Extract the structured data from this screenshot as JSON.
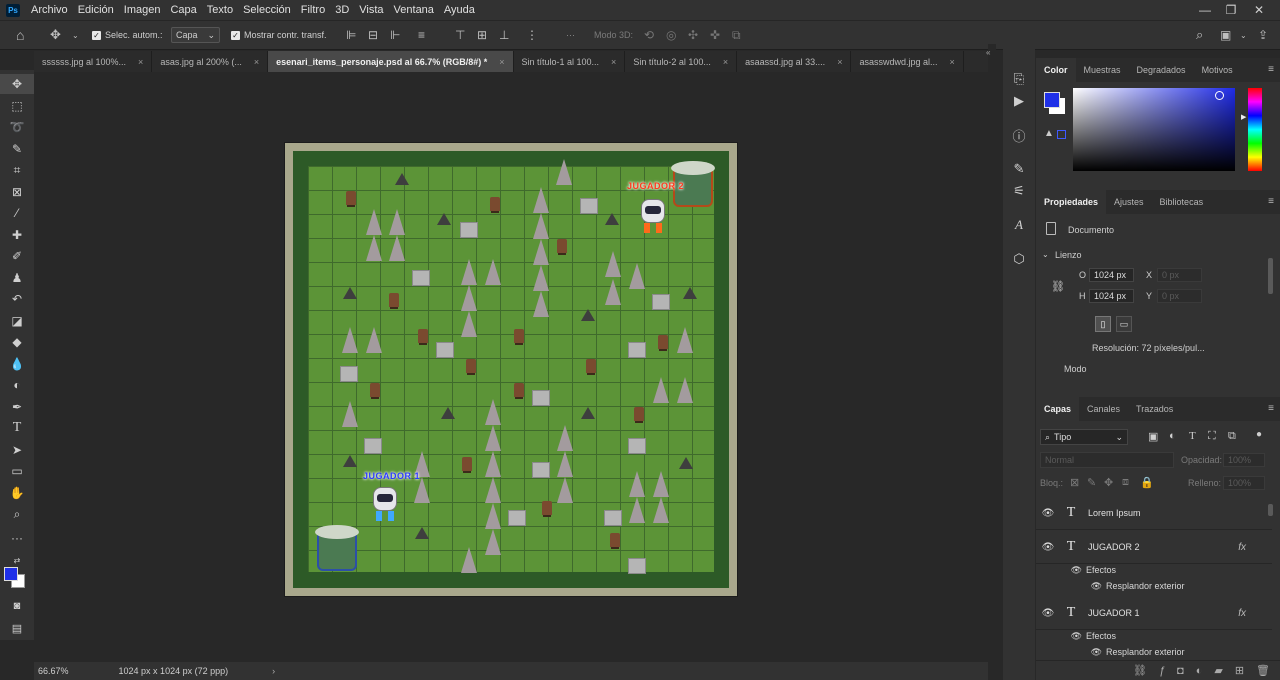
{
  "app": {
    "logo": "Ps"
  },
  "menu": [
    "Archivo",
    "Edición",
    "Imagen",
    "Capa",
    "Texto",
    "Selección",
    "Filtro",
    "3D",
    "Vista",
    "Ventana",
    "Ayuda"
  ],
  "options": {
    "auto_select_label": "Selec. autom.:",
    "auto_select_value": "Capa",
    "show_transform_label": "Mostrar contr. transf.",
    "mode3d_label": "Modo 3D:"
  },
  "tabs": [
    {
      "label": "ssssss.jpg al 100%..."
    },
    {
      "label": "asas.jpg al 200% (..."
    },
    {
      "label": "esenari_items_personaje.psd al 66.7% (RGB/8#) *",
      "active": true
    },
    {
      "label": "Sin título-1 al 100..."
    },
    {
      "label": "Sin título-2 al 100..."
    },
    {
      "label": "asaassd.jpg al 33...."
    },
    {
      "label": "asasswdwd.jpg al..."
    }
  ],
  "canvas": {
    "player2_label": "JUGADOR 2",
    "player1_label": "JUGADOR 1"
  },
  "status": {
    "zoom": "66.67%",
    "doc_info": "1024 px x 1024 px (72 ppp)",
    "arrow": "›"
  },
  "color_panel": {
    "tabs": [
      "Color",
      "Muestras",
      "Degradados",
      "Motivos"
    ],
    "foreground": "#1f30e8",
    "background": "#ffffff"
  },
  "properties_panel": {
    "tabs": [
      "Propiedades",
      "Ajustes",
      "Bibliotecas"
    ],
    "doc_label": "Documento",
    "section": "Lienzo",
    "w_label": "O",
    "w_value": "1024 px",
    "h_label": "H",
    "h_value": "1024 px",
    "x_label": "X",
    "x_placeholder": "0 px",
    "y_label": "Y",
    "y_placeholder": "0 px",
    "resolution": "Resolución: 72 píxeles/pul...",
    "mode_label": "Modo"
  },
  "layers_panel": {
    "tabs": [
      "Capas",
      "Canales",
      "Trazados"
    ],
    "filter_value": "Tipo",
    "blend_mode": "Normal",
    "opacity_label": "Opacidad:",
    "opacity_value": "100%",
    "lock_label": "Bloq.:",
    "fill_label": "Relleno:",
    "fill_value": "100%",
    "layers": [
      {
        "name": "Lorem Ipsum",
        "fx": ""
      },
      {
        "name": "JUGADOR 2",
        "fx": "fx",
        "effects_label": "Efectos",
        "effect": "Resplandor exterior"
      },
      {
        "name": "JUGADOR 1",
        "fx": "fx",
        "effects_label": "Efectos",
        "effect": "Resplandor exterior"
      }
    ]
  }
}
